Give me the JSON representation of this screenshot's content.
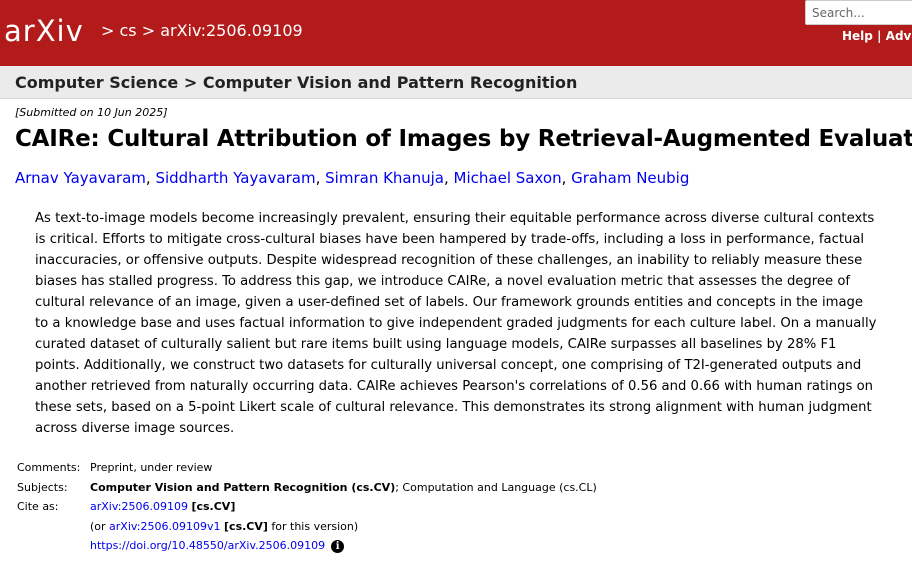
{
  "header": {
    "logo_text": "arXiv",
    "breadcrumb": "> cs > arXiv:2506.09109",
    "search_placeholder": "Search...",
    "help_link": "Help",
    "separator": "|",
    "advanced_link": "Advan"
  },
  "subheader": {
    "category": "Computer Science > Computer Vision and Pattern Recognition"
  },
  "paper": {
    "submitted": "[Submitted on 10 Jun 2025]",
    "title": "CAIRe: Cultural Attribution of Images by Retrieval-Augmented Evaluation",
    "authors": [
      "Arnav Yayavaram",
      "Siddharth Yayavaram",
      "Simran Khanuja",
      "Michael Saxon",
      "Graham Neubig"
    ],
    "author_sep": ", ",
    "abstract": "As text-to-image models become increasingly prevalent, ensuring their equitable performance across diverse cultural contexts is critical. Efforts to mitigate cross-cultural biases have been hampered by trade-offs, including a loss in performance, factual inaccuracies, or offensive outputs. Despite widespread recognition of these challenges, an inability to reliably measure these biases has stalled progress. To address this gap, we introduce CAIRe, a novel evaluation metric that assesses the degree of cultural relevance of an image, given a user-defined set of labels. Our framework grounds entities and concepts in the image to a knowledge base and uses factual information to give independent graded judgments for each culture label. On a manually curated dataset of culturally salient but rare items built using language models, CAIRe surpasses all baselines by 28% F1 points. Additionally, we construct two datasets for culturally universal concept, one comprising of T2I-generated outputs and another retrieved from naturally occurring data. CAIRe achieves Pearson's correlations of 0.56 and 0.66 with human ratings on these sets, based on a 5-point Likert scale of cultural relevance. This demonstrates its strong alignment with human judgment across diverse image sources."
  },
  "metadata": {
    "comments_label": "Comments:",
    "comments_value": "Preprint, under review",
    "subjects_label": "Subjects:",
    "subjects_primary": "Computer Vision and Pattern Recognition (cs.CV)",
    "subjects_rest": "; Computation and Language (cs.CL)",
    "cite_label": "Cite as:",
    "cite_id": "arXiv:2506.09109",
    "cite_tag": "[cs.CV]",
    "cite_or_prefix": "(or ",
    "cite_version_id": "arXiv:2506.09109v1",
    "cite_version_tag": "[cs.CV]",
    "cite_version_suffix": " for this version)",
    "doi": "https://doi.org/10.48550/arXiv.2506.09109",
    "info_glyph": "i"
  },
  "colors": {
    "header_bg": "#b31b1b",
    "link": "#0000ee",
    "subheader_bg": "#ebebeb"
  }
}
